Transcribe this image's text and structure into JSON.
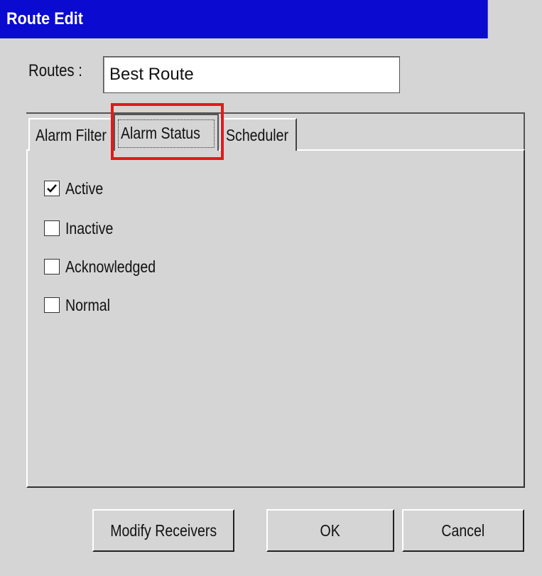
{
  "window": {
    "title": "Route Edit"
  },
  "routes": {
    "label": "Routes :",
    "value": "Best Route"
  },
  "tabs": [
    {
      "label": "Alarm Filter",
      "selected": false
    },
    {
      "label": "Alarm Status",
      "selected": true
    },
    {
      "label": "Scheduler",
      "selected": false
    }
  ],
  "checkboxes": [
    {
      "label": "Active",
      "checked": true
    },
    {
      "label": "Inactive",
      "checked": false
    },
    {
      "label": "Acknowledged",
      "checked": false
    },
    {
      "label": "Normal",
      "checked": false
    }
  ],
  "buttons": {
    "modify": "Modify Receivers",
    "ok": "OK",
    "cancel": "Cancel"
  },
  "colors": {
    "titlebar": "#0a0ad0",
    "highlight": "#e01b1b",
    "dialog_bg": "#d6d5d5"
  }
}
